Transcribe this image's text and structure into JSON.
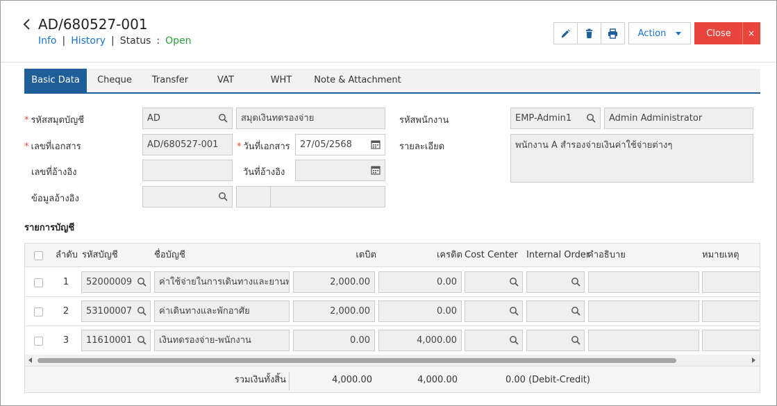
{
  "header": {
    "doc_no": "AD/680527-001",
    "nav_info": "Info",
    "nav_history": "History",
    "status_label": "Status",
    "status_colon": ":",
    "status_value": "Open",
    "status_color": "#2e9e3e"
  },
  "toolbar": {
    "edit_icon": "pencil-icon",
    "delete_icon": "trash-icon",
    "print_icon": "printer-icon",
    "action_label": "Action",
    "close_label": "Close",
    "dismiss_label": "×",
    "close_color": "#e8453c"
  },
  "tabs": [
    {
      "label": "Basic Data",
      "active": true
    },
    {
      "label": "Cheque"
    },
    {
      "label": "Transfer"
    },
    {
      "label": "VAT"
    },
    {
      "label": "WHT"
    },
    {
      "label": "Note & Attachment"
    }
  ],
  "form": {
    "book_code_label": "รหัสสมุดบัญชี",
    "book_code_value": "AD",
    "book_name_value": "สมุดเงินทดรองจ่าย",
    "employee_code_label": "รหัสพนักงาน",
    "employee_code_value": "EMP-Admin1",
    "employee_name_value": "Admin Administrator",
    "doc_no_label": "เลขที่เอกสาร",
    "doc_no_value": "AD/680527-001",
    "doc_date_label": "วันที่เอกสาร",
    "doc_date_value": "27/05/2568",
    "detail_label": "รายละเอียด",
    "detail_value": "พนักงาน A สำรองจ่ายเงินค่าใช้จ่ายต่างๆ",
    "ref_no_label": "เลขที่อ้างอิง",
    "ref_no_value": "",
    "ref_date_label": "วันที่อ้างอิง",
    "ref_date_value": "",
    "ref_info_label": "ข้อมูลอ้างอิง",
    "ref_info_value": ""
  },
  "accounts": {
    "title": "รายการบัญชี",
    "columns": {
      "seq": "ลำดับ",
      "account_code": "รหัสบัญชี",
      "account_name": "ชื่อบัญชี",
      "debit": "เดบิต",
      "credit": "เครดิต",
      "cost_center": "Cost Center",
      "internal_order": "Internal Order",
      "description": "คำอธิบาย",
      "remark": "หมายเหตุ"
    },
    "rows": [
      {
        "seq": "1",
        "code": "52000009",
        "name": "ค่าใช้จ่ายในการเดินทางและยานพาหนะ",
        "debit": "2,000.00",
        "credit": "0.00"
      },
      {
        "seq": "2",
        "code": "53100007",
        "name": "ค่าเดินทางและพักอาศัย",
        "debit": "2,000.00",
        "credit": "0.00"
      },
      {
        "seq": "3",
        "code": "11610001",
        "name": "เงินทดรองจ่าย-พนักงาน",
        "debit": "0.00",
        "credit": "4,000.00"
      }
    ],
    "footer": {
      "total_label": "รวมเงินทั้งสิ้น",
      "total_debit": "4,000.00",
      "total_credit": "4,000.00",
      "difference": "0.00 (Debit-Credit)"
    }
  }
}
